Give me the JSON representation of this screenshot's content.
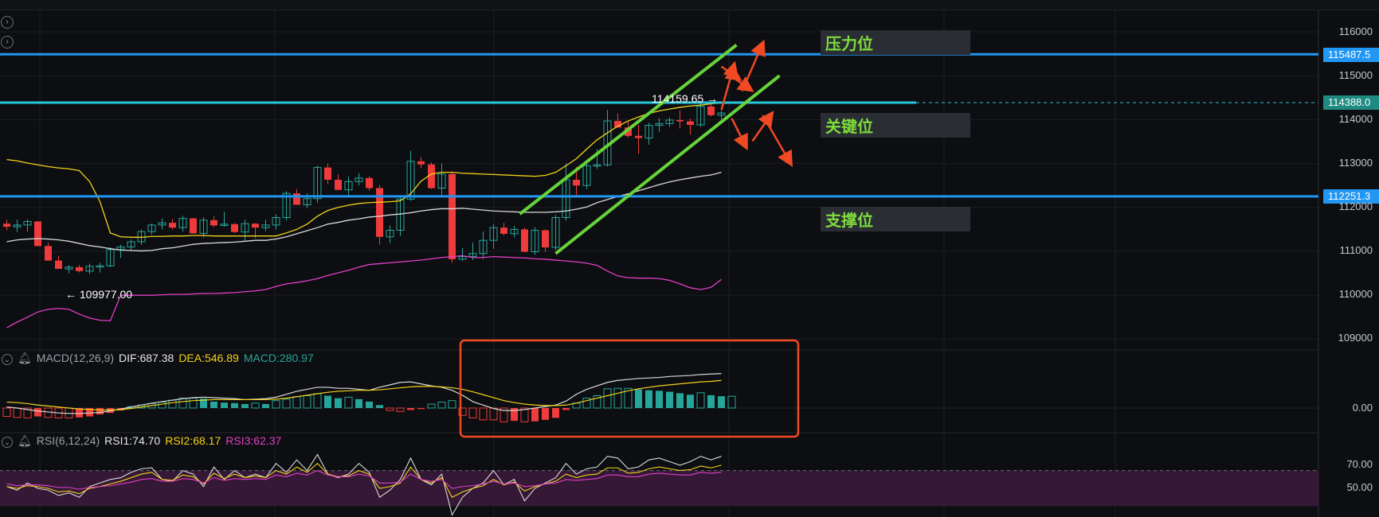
{
  "chart_data": {
    "type": "candlestick",
    "price_axis": {
      "ylim": [
        108000,
        117000
      ],
      "ticks": [
        116000,
        115000,
        114000,
        113000,
        112000,
        111000,
        110000,
        109000
      ]
    },
    "candles": [
      [
        111630,
        111720,
        111480,
        111560
      ],
      [
        111560,
        111720,
        111440,
        111600
      ],
      [
        111600,
        111730,
        111450,
        111680
      ],
      [
        111680,
        111690,
        111260,
        111120
      ],
      [
        111120,
        111200,
        110820,
        110790
      ],
      [
        110790,
        110900,
        110610,
        110600
      ],
      [
        110600,
        110690,
        110500,
        110640
      ],
      [
        110640,
        110690,
        110520,
        110550
      ],
      [
        110550,
        110720,
        110480,
        110660
      ],
      [
        110660,
        110740,
        110520,
        110670
      ],
      [
        110670,
        111090,
        110640,
        111040
      ],
      [
        111040,
        111150,
        110850,
        111100
      ],
      [
        111100,
        111270,
        111010,
        111220
      ],
      [
        111220,
        111500,
        111150,
        111450
      ],
      [
        111450,
        111630,
        111380,
        111600
      ],
      [
        111600,
        111750,
        111500,
        111650
      ],
      [
        111650,
        111730,
        111500,
        111540
      ],
      [
        111540,
        111810,
        111450,
        111750
      ],
      [
        111750,
        111760,
        111400,
        111410
      ],
      [
        111410,
        111780,
        111320,
        111710
      ],
      [
        111710,
        111800,
        111550,
        111590
      ],
      [
        111590,
        111900,
        111560,
        111620
      ],
      [
        111620,
        111640,
        111420,
        111440
      ],
      [
        111440,
        111720,
        111250,
        111630
      ],
      [
        111630,
        111640,
        111300,
        111540
      ],
      [
        111540,
        111720,
        111460,
        111600
      ],
      [
        111600,
        111840,
        111500,
        111770
      ],
      [
        111770,
        112370,
        111700,
        112320
      ],
      [
        112320,
        112420,
        112070,
        112060
      ],
      [
        112060,
        112320,
        111990,
        112200
      ],
      [
        112200,
        112950,
        112100,
        112910
      ],
      [
        112910,
        113000,
        112540,
        112630
      ],
      [
        112630,
        112760,
        112410,
        112400
      ],
      [
        112400,
        112700,
        112230,
        112590
      ],
      [
        112590,
        112780,
        112500,
        112670
      ],
      [
        112670,
        112710,
        112380,
        112440
      ],
      [
        112440,
        112510,
        111150,
        111330
      ],
      [
        111330,
        111590,
        111190,
        111480
      ],
      [
        111480,
        112230,
        111350,
        112190
      ],
      [
        112190,
        113290,
        112150,
        113050
      ],
      [
        113050,
        113150,
        112890,
        112980
      ],
      [
        112980,
        113030,
        112420,
        112440
      ],
      [
        112440,
        113000,
        112260,
        112760
      ],
      [
        112760,
        112820,
        110740,
        110820
      ],
      [
        110820,
        111080,
        110780,
        110880
      ],
      [
        110880,
        111200,
        110800,
        110950
      ],
      [
        110950,
        111450,
        110830,
        111250
      ],
      [
        111250,
        111620,
        111060,
        111540
      ],
      [
        111540,
        111650,
        111360,
        111400
      ],
      [
        111400,
        111580,
        111320,
        111500
      ],
      [
        111500,
        111540,
        110980,
        110990
      ],
      [
        110990,
        111550,
        110920,
        111480
      ],
      [
        111480,
        111500,
        110990,
        111090
      ],
      [
        111090,
        111830,
        111030,
        111770
      ],
      [
        111770,
        113000,
        111700,
        112630
      ],
      [
        112630,
        112920,
        112250,
        112500
      ],
      [
        112500,
        113020,
        112420,
        112950
      ],
      [
        112950,
        113330,
        112880,
        112970
      ],
      [
        112970,
        114220,
        112930,
        113970
      ],
      [
        113970,
        114140,
        113820,
        113820
      ],
      [
        113820,
        113960,
        113590,
        113630
      ],
      [
        113630,
        113880,
        113220,
        113580
      ],
      [
        113580,
        113930,
        113430,
        113870
      ],
      [
        113870,
        114030,
        113720,
        113910
      ],
      [
        113910,
        114050,
        113840,
        113990
      ],
      [
        113990,
        114210,
        113800,
        113960
      ],
      [
        113960,
        114020,
        113660,
        113880
      ],
      [
        113880,
        114380,
        113840,
        114300
      ],
      [
        114300,
        114380,
        114070,
        114100
      ],
      [
        114100,
        114200,
        114000,
        114150
      ]
    ],
    "bollinger": {
      "upper": [
        113090,
        113060,
        113010,
        112970,
        112930,
        112900,
        112880,
        112840,
        112590,
        112130,
        111420,
        111330,
        111320,
        111320,
        111340,
        111340,
        111350,
        111350,
        111360,
        111360,
        111350,
        111350,
        111350,
        111350,
        111350,
        111350,
        111350,
        111420,
        111500,
        111620,
        111800,
        111930,
        112000,
        112050,
        112090,
        112110,
        112120,
        112130,
        112150,
        112310,
        112600,
        112760,
        112800,
        112800,
        112780,
        112770,
        112760,
        112750,
        112740,
        112730,
        112720,
        112710,
        112730,
        112800,
        112950,
        113110,
        113330,
        113540,
        113700,
        113850,
        113970,
        114060,
        114140,
        114200,
        114240,
        114280,
        114310,
        114330,
        114360,
        114380
      ],
      "middle": [
        111220,
        111260,
        111280,
        111290,
        111280,
        111260,
        111230,
        111180,
        111130,
        111100,
        111060,
        111030,
        111020,
        111010,
        111020,
        111060,
        111080,
        111120,
        111160,
        111180,
        111190,
        111200,
        111210,
        111230,
        111250,
        111250,
        111280,
        111330,
        111400,
        111470,
        111540,
        111620,
        111660,
        111710,
        111740,
        111780,
        111800,
        111830,
        111850,
        111880,
        111920,
        111950,
        111970,
        111970,
        111980,
        111960,
        111940,
        111920,
        111910,
        111900,
        111890,
        111890,
        111890,
        111900,
        111920,
        111960,
        112010,
        112110,
        112180,
        112250,
        112310,
        112380,
        112450,
        112520,
        112580,
        112630,
        112670,
        112710,
        112740,
        112800
      ],
      "lower": [
        109260,
        109390,
        109500,
        109620,
        109680,
        109700,
        109680,
        109570,
        109480,
        109430,
        109420,
        110000,
        110000,
        110000,
        110000,
        110010,
        110020,
        110020,
        110030,
        110040,
        110040,
        110050,
        110060,
        110080,
        110100,
        110130,
        110200,
        110260,
        110290,
        110330,
        110380,
        110450,
        110510,
        110570,
        110640,
        110700,
        110720,
        110740,
        110760,
        110780,
        110800,
        110830,
        110860,
        110880,
        110900,
        110860,
        110860,
        110880,
        110870,
        110860,
        110850,
        110830,
        110820,
        110800,
        110780,
        110760,
        110730,
        110680,
        110550,
        110440,
        110400,
        110390,
        110390,
        110380,
        110340,
        110260,
        110170,
        110130,
        110180,
        110360
      ]
    },
    "annotations": {
      "high_label": "114159.65 →",
      "low_label": "← 109977.00",
      "high_value": 114159.65,
      "low_value": 109977.0
    },
    "levels": [
      {
        "price": 115487.5,
        "label": "115487.5",
        "color": "#2196f3"
      },
      {
        "price": 114388.0,
        "label": "114388.0",
        "color": "#26c6da"
      },
      {
        "price": 112251.3,
        "label": "112251.3",
        "color": "#2196f3"
      }
    ],
    "zone_labels": [
      {
        "text": "压力位",
        "price": 115800
      },
      {
        "text": "关键位",
        "price": 113900
      },
      {
        "text": "支撑位",
        "price": 111790
      }
    ],
    "channel": {
      "color": "#67d33a"
    },
    "macd": {
      "label": "MACD(12,26,9)",
      "dif_label": "DIF:687.38",
      "dea_label": "DEA:546.89",
      "macd_label": "MACD:280.97",
      "zero_tick": "0.00",
      "hist": [
        -170,
        -190,
        -200,
        -170,
        -190,
        -200,
        -200,
        -190,
        -170,
        -130,
        -100,
        -50,
        30,
        60,
        90,
        120,
        160,
        200,
        200,
        190,
        130,
        110,
        100,
        80,
        100,
        80,
        150,
        180,
        230,
        250,
        290,
        250,
        200,
        220,
        180,
        130,
        60,
        -50,
        -70,
        -40,
        -20,
        80,
        120,
        150,
        -150,
        -200,
        -240,
        -240,
        -280,
        -260,
        -280,
        -270,
        -240,
        -200,
        -40,
        100,
        200,
        250,
        390,
        400,
        400,
        380,
        360,
        350,
        330,
        300,
        270,
        310,
        260,
        240,
        240
      ],
      "dif": [
        20,
        0,
        -30,
        -60,
        -80,
        -100,
        -110,
        -110,
        -100,
        -90,
        -60,
        -20,
        20,
        60,
        100,
        130,
        160,
        190,
        210,
        220,
        210,
        200,
        190,
        170,
        180,
        190,
        220,
        280,
        340,
        380,
        420,
        420,
        400,
        400,
        380,
        360,
        420,
        470,
        520,
        530,
        490,
        450,
        420,
        360,
        260,
        130,
        60,
        -10,
        -50,
        -50,
        -30,
        0,
        30,
        60,
        140,
        280,
        380,
        450,
        520,
        560,
        580,
        600,
        610,
        620,
        640,
        650,
        660,
        680,
        690,
        700
      ],
      "dea": [
        120,
        110,
        90,
        60,
        40,
        20,
        0,
        -20,
        -30,
        -40,
        -40,
        -30,
        -10,
        20,
        50,
        80,
        110,
        130,
        150,
        160,
        170,
        170,
        170,
        170,
        170,
        170,
        180,
        200,
        230,
        260,
        290,
        320,
        340,
        350,
        360,
        360,
        370,
        390,
        410,
        430,
        440,
        440,
        430,
        410,
        380,
        330,
        270,
        210,
        150,
        110,
        80,
        60,
        50,
        50,
        60,
        100,
        150,
        200,
        250,
        300,
        350,
        390,
        420,
        450,
        470,
        490,
        510,
        530,
        540,
        560
      ]
    },
    "rsi": {
      "label": "RSI(6,12,24)",
      "rsi1_label": "RSI1:74.70",
      "rsi2_label": "RSI2:68.17",
      "rsi3_label": "RSI3:62.37",
      "ticks": [
        "70.00",
        "50.00"
      ],
      "rsi1": [
        52,
        48,
        56,
        50,
        48,
        42,
        45,
        40,
        52,
        56,
        60,
        62,
        68,
        72,
        73,
        60,
        58,
        70,
        66,
        52,
        74,
        60,
        70,
        62,
        66,
        62,
        78,
        68,
        82,
        70,
        88,
        66,
        62,
        66,
        78,
        68,
        40,
        48,
        60,
        84,
        60,
        54,
        66,
        20,
        40,
        50,
        56,
        70,
        54,
        60,
        36,
        50,
        56,
        62,
        78,
        66,
        72,
        74,
        86,
        84,
        72,
        74,
        82,
        84,
        80,
        76,
        80,
        86,
        82,
        86
      ],
      "rsi2": [
        52,
        50,
        53,
        52,
        50,
        46,
        47,
        44,
        50,
        52,
        55,
        58,
        62,
        66,
        68,
        60,
        59,
        65,
        63,
        55,
        67,
        61,
        66,
        62,
        64,
        62,
        70,
        66,
        74,
        68,
        78,
        66,
        63,
        64,
        70,
        66,
        50,
        52,
        56,
        74,
        60,
        56,
        62,
        40,
        46,
        50,
        53,
        60,
        54,
        57,
        47,
        52,
        55,
        58,
        66,
        62,
        65,
        66,
        73,
        73,
        67,
        68,
        72,
        74,
        72,
        70,
        71,
        75,
        73,
        76
      ],
      "rsi3": [
        55,
        53,
        54,
        54,
        53,
        51,
        51,
        49,
        51,
        52,
        53,
        55,
        57,
        60,
        61,
        58,
        58,
        61,
        60,
        56,
        62,
        59,
        61,
        60,
        61,
        60,
        65,
        63,
        67,
        65,
        70,
        65,
        63,
        63,
        66,
        64,
        56,
        56,
        57,
        66,
        60,
        58,
        60,
        50,
        52,
        53,
        55,
        58,
        55,
        56,
        52,
        53,
        55,
        56,
        60,
        59,
        60,
        61,
        65,
        65,
        63,
        63,
        66,
        67,
        66,
        65,
        65,
        68,
        67,
        68
      ]
    },
    "indicator_colors": {
      "up": "#26a69a",
      "down": "#ef3b3b",
      "dif": "#d9d9d9",
      "dea": "#f2d31b",
      "rsi1": "#d9d9d9",
      "rsi2": "#f2d31b",
      "rsi3": "#e040c8",
      "bb_upper": "#f2d31b",
      "bb_middle": "#d9d9d9",
      "bb_lower": "#e040c8",
      "rsi_band": "#3a1a3a"
    }
  }
}
